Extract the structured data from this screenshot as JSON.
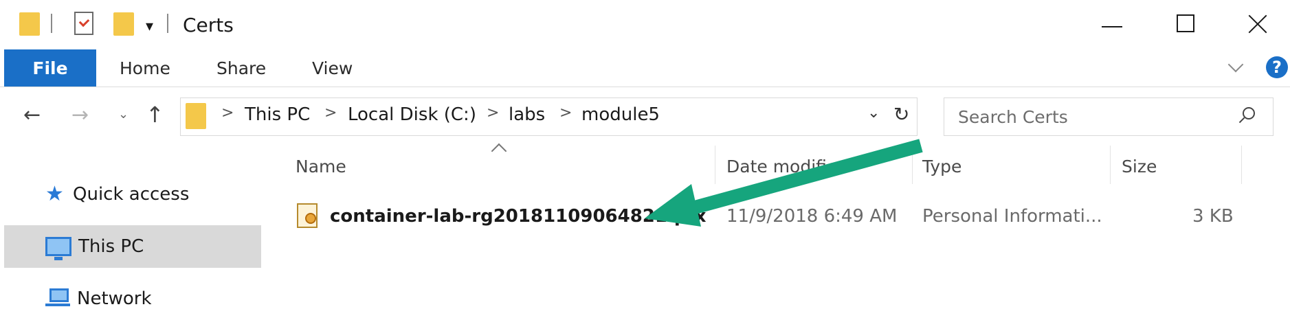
{
  "window": {
    "title": "Certs",
    "qat_dropdown_icon": "dropdown-caret"
  },
  "ribbon": {
    "tabs": [
      {
        "label": "File",
        "active": true
      },
      {
        "label": "Home"
      },
      {
        "label": "Share"
      },
      {
        "label": "View"
      }
    ],
    "help_label": "?"
  },
  "address": {
    "crumbs": [
      "This PC",
      "Local Disk (C:)",
      "labs",
      "module5"
    ],
    "separator": ">"
  },
  "search": {
    "placeholder": "Search Certs"
  },
  "nav_pane": {
    "items": [
      {
        "label": "Quick access",
        "icon": "star-icon"
      },
      {
        "label": "This PC",
        "icon": "computer-icon",
        "selected": true
      },
      {
        "label": "Network",
        "icon": "network-icon"
      }
    ]
  },
  "file_list": {
    "columns": [
      "Name",
      "Date modified",
      "Type",
      "Size"
    ],
    "rows": [
      {
        "name": "container-lab-rg20181109064821.pfx",
        "date_modified": "11/9/2018 6:49 AM",
        "type": "Personal Informati...",
        "size": "3 KB"
      }
    ]
  },
  "colors": {
    "accent": "#1a6fc7",
    "folder": "#f4c84a",
    "annotation_arrow": "#16a57d",
    "selection": "#d9d9d9"
  }
}
